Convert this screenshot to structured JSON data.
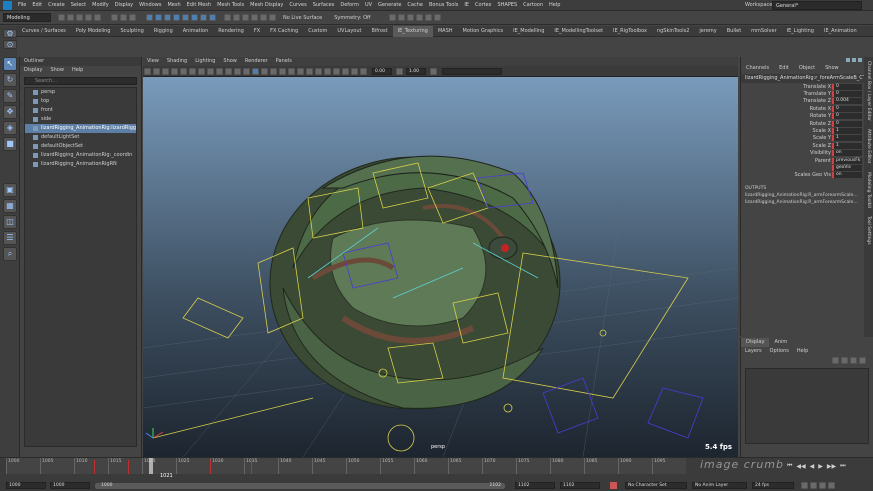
{
  "menubar": {
    "items": [
      "File",
      "Edit",
      "Create",
      "Select",
      "Modify",
      "Display",
      "Windows",
      "Mesh",
      "Edit Mesh",
      "Mesh Tools",
      "Mesh Display",
      "Curves",
      "Surfaces",
      "Deform",
      "UV",
      "Generate",
      "Cache",
      "Bonus Tools",
      "IE",
      "Cortex",
      "SHAPES",
      "Cartoon",
      "Help"
    ],
    "workspace_label": "Workspace:",
    "workspace_value": "General*"
  },
  "statusline": {
    "mode": "Modeling",
    "live_surface": "No Live Surface",
    "symmetry": "Symmetry: Off"
  },
  "shelf_tabs": [
    "Curves / Surfaces",
    "Poly Modeling",
    "Sculpting",
    "Rigging",
    "Animation",
    "Rendering",
    "FX",
    "FX Caching",
    "Custom",
    "UVLayout",
    "Bifrost",
    "IE_Texturing",
    "MASH",
    "Motion Graphics",
    "IE_Modelling",
    "IE_ModellingToolset",
    "IE_RigToolbox",
    "ngSkinTools2",
    "jeremy",
    "Bullet",
    "mmSolver",
    "IE_Lighting",
    "IE_Animation"
  ],
  "shelf_active": "IE_Texturing",
  "outliner": {
    "title": "Outliner",
    "menus": [
      "Display",
      "Show",
      "Help"
    ],
    "search_placeholder": "Search...",
    "items": [
      {
        "label": "persp",
        "highlight": false,
        "indent": 0
      },
      {
        "label": "top",
        "highlight": false,
        "indent": 0
      },
      {
        "label": "front",
        "highlight": false,
        "indent": 0
      },
      {
        "label": "side",
        "highlight": false,
        "indent": 0
      },
      {
        "label": "lizardRigging_AnimationRig:lizardRigg",
        "highlight": true,
        "indent": 0
      },
      {
        "label": "defaultLightSet",
        "highlight": false,
        "indent": 0
      },
      {
        "label": "defaultObjectSet",
        "highlight": false,
        "indent": 0
      },
      {
        "label": "lizardRigging_AnimationRig:_coordin",
        "highlight": false,
        "indent": 0
      },
      {
        "label": "lizardRigging_AnimationRigRN",
        "highlight": false,
        "indent": 0
      }
    ]
  },
  "viewport": {
    "menus": [
      "View",
      "Shading",
      "Lighting",
      "Show",
      "Renderer",
      "Panels"
    ],
    "near_value": "0.00",
    "far_value": "1.00",
    "camera_label": "persp",
    "fps": "5.4 fps"
  },
  "attribute_editor": {
    "menus": [
      "Channels",
      "Edit",
      "Object",
      "Show"
    ],
    "node_name": "lizardRigging_AnimationRig:r_foreArmScaleB_CT...",
    "rows": [
      {
        "label": "Translate X",
        "value": "0"
      },
      {
        "label": "Translate Y",
        "value": "0"
      },
      {
        "label": "Translate Z",
        "value": "0.004"
      },
      {
        "label": "Rotate X",
        "value": "0"
      },
      {
        "label": "Rotate Y",
        "value": "0"
      },
      {
        "label": "Rotate Z",
        "value": "0"
      },
      {
        "label": "Scale X",
        "value": "1"
      },
      {
        "label": "Scale Y",
        "value": "1"
      },
      {
        "label": "Scale Z",
        "value": "1"
      },
      {
        "label": "Visibility",
        "value": "on"
      },
      {
        "label": "Parent",
        "value": "previousFk"
      },
      {
        "label": "",
        "value": "geoVis"
      },
      {
        "label": "Scales Geo Vis",
        "value": "on"
      }
    ],
    "outputs_title": "OUTPUTS",
    "outputs": [
      "lizardRigging_AnimationRig:R_armForearmScale...",
      "lizardRigging_AnimationRig:R_armForearmScale..."
    ]
  },
  "side_tabs": [
    "Channel Box / Layer Editor",
    "Attribute Editor",
    "Modeling Toolkit",
    "Tool Settings"
  ],
  "layers": {
    "tabs": [
      "Display",
      "Anim"
    ],
    "active_tab": "Display",
    "menus": [
      "Layers",
      "Options",
      "Help"
    ]
  },
  "timeline": {
    "ticks": [
      "1000",
      "1005",
      "1010",
      "1015",
      "1020",
      "1025",
      "1030",
      "1035",
      "1040",
      "1045",
      "1050",
      "1055",
      "1060",
      "1065",
      "1070",
      "1075",
      "1080",
      "1085",
      "1090",
      "1095"
    ],
    "current_frame": "1021"
  },
  "range": {
    "start": "1000",
    "start2": "1000",
    "range_start": "1000",
    "range_end": "1102",
    "end": "1102",
    "end2": "1102",
    "character_set": "No Character Set",
    "anim_layer": "No Anim Layer",
    "fps": "24 fps"
  },
  "watermark": "image crumb"
}
